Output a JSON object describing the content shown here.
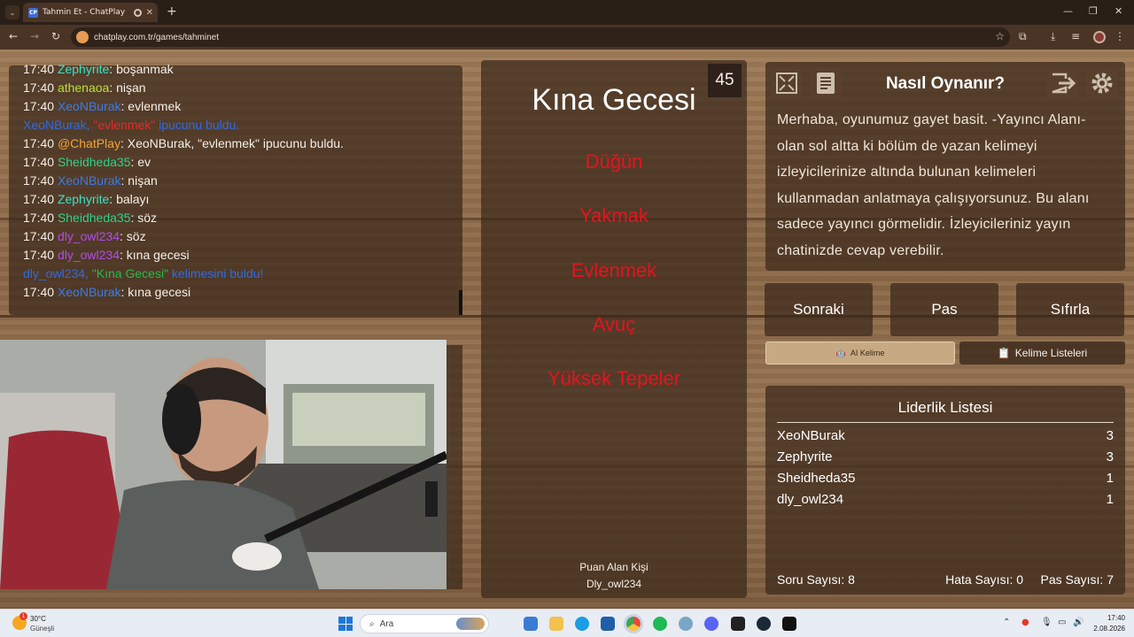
{
  "browser": {
    "tab_title": "Tahmin Et - ChatPlay",
    "tab_favicon": "CP",
    "url": "chatplay.com.tr/games/tahminet"
  },
  "chat": {
    "lines": [
      {
        "time": "17:40",
        "user": "Zephyrite",
        "text": ": boşanmak"
      },
      {
        "time": "17:40",
        "user": "athenaoa",
        "text": ": nişan"
      },
      {
        "time": "17:40",
        "user": "XeoNBurak",
        "text": ": evlenmek"
      },
      {
        "time": "",
        "user": "",
        "text": ""
      },
      {
        "time": "17:40",
        "user": "@ChatPlay",
        "text": ": XeoNBurak, \"evlenmek\" ipucunu buldu."
      },
      {
        "time": "17:40",
        "user": "Sheidheda35",
        "text": ": ev"
      },
      {
        "time": "17:40",
        "user": "XeoNBurak",
        "text": ": nişan"
      },
      {
        "time": "17:40",
        "user": "Zephyrite",
        "text": ": balayı"
      },
      {
        "time": "17:40",
        "user": "Sheidheda35",
        "text": ": söz"
      },
      {
        "time": "17:40",
        "user": "dly_owl234",
        "text": ": söz"
      },
      {
        "time": "17:40",
        "user": "dly_owl234",
        "text": ": kına gecesi"
      },
      {
        "time": "",
        "user": "",
        "text": ""
      },
      {
        "time": "17:40",
        "user": "XeoNBurak",
        "text": ": kına gecesi"
      }
    ],
    "system1": {
      "prefix": "XeoNBurak, ",
      "word": "\"evlenmek\"",
      "suffix": " ipucunu buldu."
    },
    "system2": {
      "prefix": "dly_owl234, ",
      "word": "\"Kına Gecesi\"",
      "suffix": " kelimesini buldu!"
    }
  },
  "game": {
    "timer": "45",
    "main_word": "Kına Gecesi",
    "banned_words": [
      "Düğün",
      "Yakmak",
      "Evlenmek",
      "Avuç",
      "Yüksek Tepeler"
    ],
    "scorer_label": "Puan Alan Kişi",
    "scorer_name": "Dly_owl234"
  },
  "howto": {
    "title": "Nasıl Oynanır?",
    "text": "Merhaba, oyunumuz gayet basit. -Yayıncı Alanı- olan sol altta ki bölüm de yazan kelimeyi izleyicilerinize altında bulunan kelimeleri kullanmadan anlatmaya çalışıyorsunuz. Bu alanı sadece yayıncı görmelidir. İzleyicileriniz yayın chatinizde cevap verebilir."
  },
  "controls": {
    "next": "Sonraki",
    "pass": "Pas",
    "reset": "Sıfırla",
    "ai_word": "AI Kelime",
    "word_lists": "Kelime Listeleri"
  },
  "leaderboard": {
    "title": "Liderlik Listesi",
    "rows": [
      {
        "name": "XeoNBurak",
        "score": "3"
      },
      {
        "name": "Zephyrite",
        "score": "3"
      },
      {
        "name": "Sheidheda35",
        "score": "1"
      },
      {
        "name": "dly_owl234",
        "score": "1"
      }
    ],
    "question_count_label": "Soru Sayısı:",
    "question_count": "8",
    "error_count_label": "Hata Sayısı:",
    "error_count": "0",
    "pass_count_label": "Pas Sayısı:",
    "pass_count": "7"
  },
  "taskbar": {
    "weather_temp": "30°C",
    "weather_desc": "Güneşli",
    "weather_badge": "1",
    "search_placeholder": "Ara",
    "time": "17:40",
    "date": "2.08.2026"
  }
}
